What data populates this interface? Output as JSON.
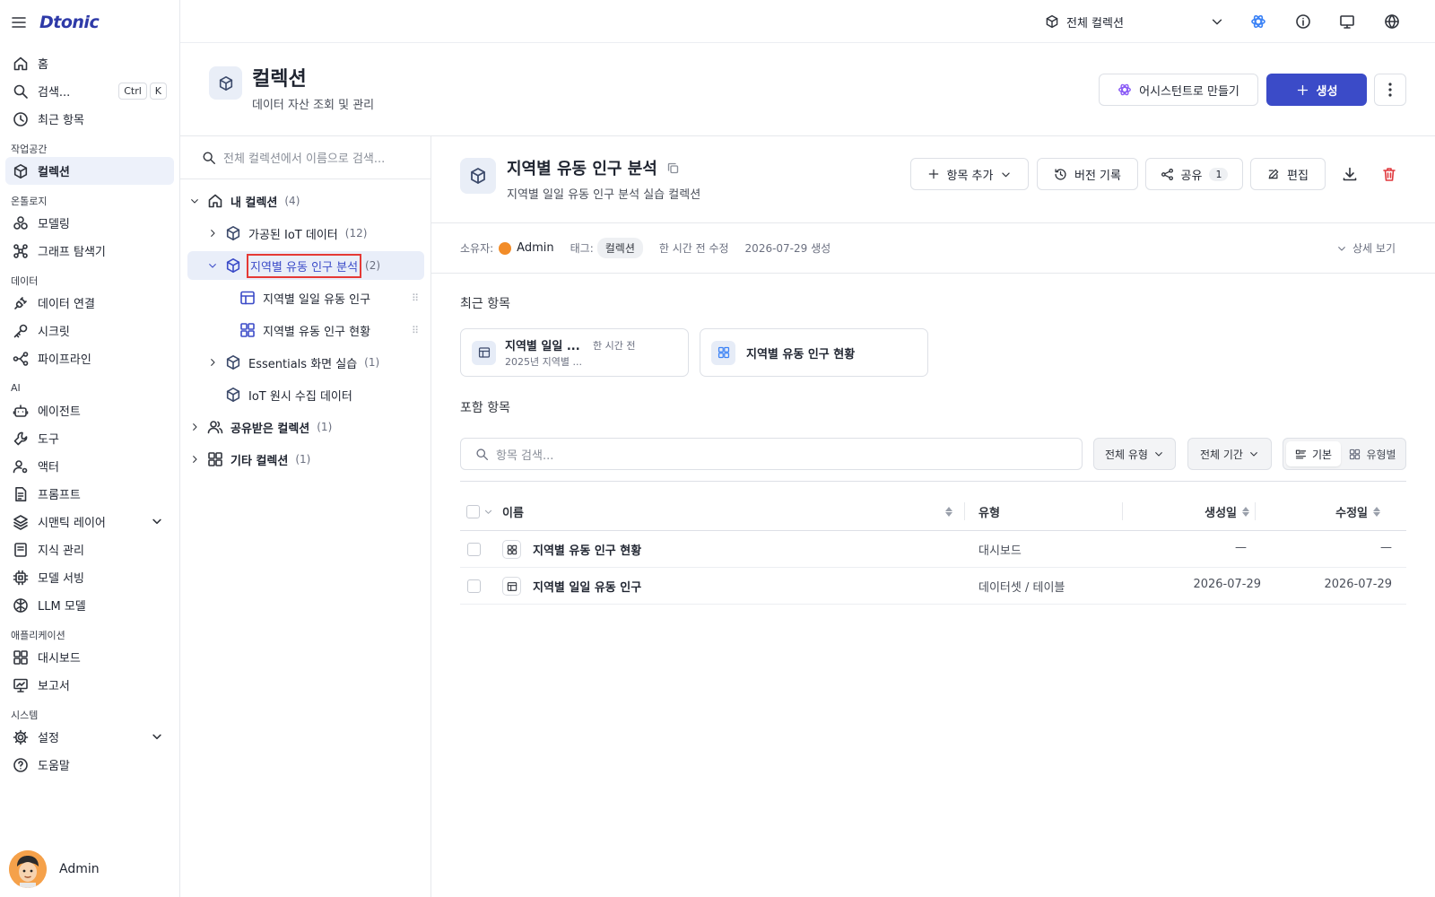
{
  "brand": "Dtonic",
  "sidebar": {
    "home": "홈",
    "search": "검색...",
    "shortcut_ctrl": "Ctrl",
    "shortcut_k": "K",
    "recent": "최근 항목",
    "sec_workspace": "작업공간",
    "collections": "컬렉션",
    "sec_ontology": "온톨로지",
    "modeling": "모델링",
    "graph": "그래프 탐색기",
    "sec_data": "데이터",
    "data_conn": "데이터 연결",
    "secret": "시크릿",
    "pipeline": "파이프라인",
    "sec_ai": "AI",
    "agent": "에이전트",
    "tool": "도구",
    "actor": "액터",
    "prompt": "프롬프트",
    "semantic": "시맨틱 레이어",
    "knowledge": "지식 관리",
    "serving": "모델 서빙",
    "llm": "LLM 모델",
    "sec_app": "애플리케이션",
    "dashboard": "대시보드",
    "report": "보고서",
    "sec_system": "시스템",
    "settings": "설정",
    "help": "도움말",
    "user": "Admin"
  },
  "topbar": {
    "scope": "전체 컬렉션"
  },
  "header": {
    "title": "컬렉션",
    "subtitle": "데이터 자산 조회 및 관리",
    "assistant_btn": "어시스턴트로 만들기",
    "create_btn": "생성"
  },
  "tree": {
    "search_placeholder": "전체 컬렉션에서 이름으로 검색...",
    "my": {
      "label": "내 컬렉션",
      "count": "(4)"
    },
    "iot": {
      "label": "가공된 IoT 데이터",
      "count": "(12)"
    },
    "pop": {
      "label": "지역별 유동 인구 분석",
      "count": "(2)"
    },
    "daily": "지역별 일일 유동 인구",
    "status": "지역별 유동 인구 현황",
    "essentials": {
      "label": "Essentials 화면 실습",
      "count": "(1)"
    },
    "raw": "IoT 원시 수집 데이터",
    "shared": {
      "label": "공유받은 컬렉션",
      "count": "(1)"
    },
    "other": {
      "label": "기타 컬렉션",
      "count": "(1)"
    }
  },
  "detail": {
    "title": "지역별 유동 인구 분석",
    "desc": "지역별 일일 유동 인구 분석 실습 컬렉션",
    "add_btn": "항목 추가",
    "version_btn": "버전 기록",
    "share_btn": "공유",
    "share_count": "1",
    "edit_btn": "편집",
    "owner_label": "소유자:",
    "owner": "Admin",
    "tag_label": "태그:",
    "tag": "컬렉션",
    "modified": "한 시간 전 수정",
    "created": "2026-07-29 생성",
    "more": "상세 보기",
    "recent_title": "최근 항목",
    "recent": [
      {
        "title": "지역별 일일 ...",
        "sub": "2025년 지역별 ...",
        "time": "한 시간 전"
      },
      {
        "title": "지역별 유동 인구 현황"
      }
    ],
    "included_title": "포함 항목",
    "item_search": "항목 검색...",
    "filter_type": "전체 유형",
    "filter_period": "전체 기간",
    "view_basic": "기본",
    "view_type": "유형별",
    "columns": {
      "name": "이름",
      "type": "유형",
      "created": "생성일",
      "modified": "수정일"
    },
    "rows": [
      {
        "name": "지역별 유동 인구 현황",
        "type": "대시보드",
        "created": "—",
        "modified": "—"
      },
      {
        "name": "지역별 일일 유동 인구",
        "type": "데이터셋 / 테이블",
        "created": "2026-07-29",
        "modified": "2026-07-29"
      }
    ]
  },
  "colors": {
    "accent": "#3b4bc8",
    "danger": "#e0393e",
    "selection": "#e53935"
  }
}
